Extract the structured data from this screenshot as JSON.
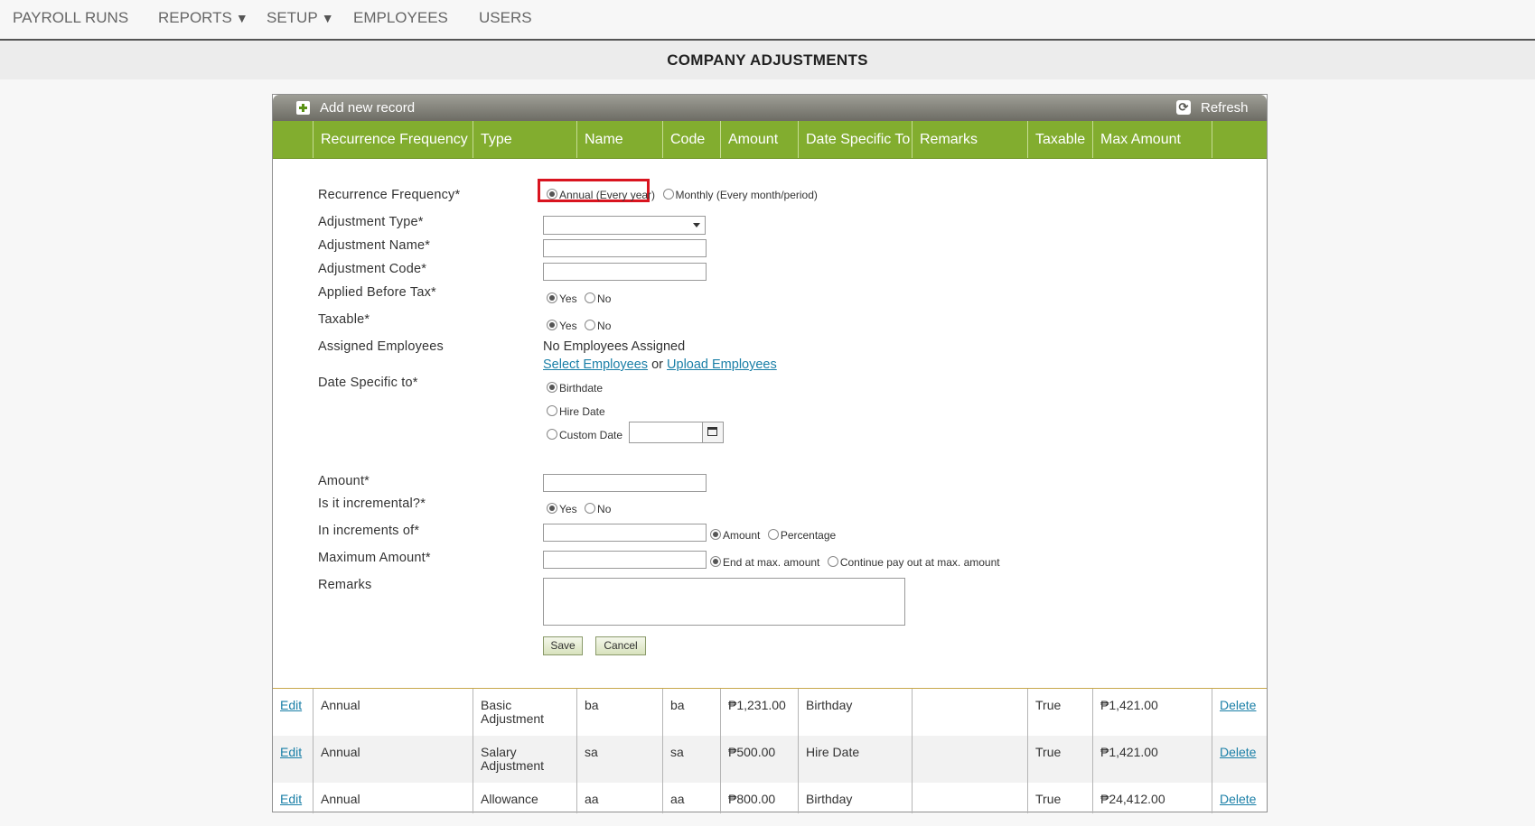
{
  "nav": {
    "items": [
      {
        "label": "PAYROLL RUNS",
        "caret": ""
      },
      {
        "label": "REPORTS",
        "caret": "▼"
      },
      {
        "label": "SETUP",
        "caret": "▼"
      },
      {
        "label": "EMPLOYEES",
        "caret": ""
      },
      {
        "label": "USERS",
        "caret": ""
      }
    ]
  },
  "page": {
    "title": "COMPANY ADJUSTMENTS"
  },
  "toolbar": {
    "add_label": "Add new record",
    "refresh_label": "Refresh",
    "add_icon": "plus-icon",
    "refresh_icon": "refresh-icon"
  },
  "columns": [
    "Recurrence Frequency",
    "Type",
    "Name",
    "Code",
    "Amount",
    "Date Specific To",
    "Remarks",
    "Taxable",
    "Max Amount"
  ],
  "form": {
    "recurrence": {
      "label": "Recurrence Frequency*",
      "options": [
        "Annual (Every year)",
        "Monthly (Every month/period)"
      ],
      "selected": "Annual (Every year)"
    },
    "adjustment_type": {
      "label": "Adjustment Type*",
      "value": ""
    },
    "adjustment_name": {
      "label": "Adjustment Name*",
      "value": ""
    },
    "adjustment_code": {
      "label": "Adjustment Code*",
      "value": ""
    },
    "applied_before_tax": {
      "label": "Applied Before Tax*",
      "options": [
        "Yes",
        "No"
      ],
      "selected": "Yes"
    },
    "taxable": {
      "label": "Taxable*",
      "options": [
        "Yes",
        "No"
      ],
      "selected": "Yes"
    },
    "assigned_employees": {
      "label": "Assigned Employees",
      "status": "No Employees Assigned",
      "select_link": "Select Employees",
      "or_text": "or",
      "upload_link": "Upload Employees"
    },
    "date_specific": {
      "label": "Date Specific to*",
      "options": [
        "Birthdate",
        "Hire Date",
        "Custom Date"
      ],
      "selected": "Birthdate",
      "custom_date_value": ""
    },
    "amount": {
      "label": "Amount*",
      "value": ""
    },
    "incremental": {
      "label": "Is it incremental?*",
      "options": [
        "Yes",
        "No"
      ],
      "selected": "Yes"
    },
    "increments": {
      "label": "In increments of*",
      "value": "",
      "options": [
        "Amount",
        "Percentage"
      ],
      "selected": "Amount"
    },
    "maximum_amount": {
      "label": "Maximum Amount*",
      "value": "",
      "options": [
        "End at max. amount",
        "Continue pay out at max. amount"
      ],
      "selected": "End at max. amount"
    },
    "remarks": {
      "label": "Remarks",
      "value": ""
    },
    "save_label": "Save",
    "cancel_label": "Cancel"
  },
  "rows": [
    {
      "edit": "Edit",
      "recurrence": "Annual",
      "type": "Basic Adjustment",
      "name": "ba",
      "code": "ba",
      "amount": "₱1,231.00",
      "date_specific": "Birthday",
      "remarks": "",
      "taxable": "True",
      "max_amount": "₱1,421.00",
      "delete": "Delete"
    },
    {
      "edit": "Edit",
      "recurrence": "Annual",
      "type": "Salary Adjustment",
      "name": "sa",
      "code": "sa",
      "amount": "₱500.00",
      "date_specific": "Hire Date",
      "remarks": "",
      "taxable": "True",
      "max_amount": "₱1,421.00",
      "delete": "Delete"
    },
    {
      "edit": "Edit",
      "recurrence": "Annual",
      "type": "Allowance",
      "name": "aa",
      "code": "aa",
      "amount": "₱800.00",
      "date_specific": "Birthday",
      "remarks": "",
      "taxable": "True",
      "max_amount": "₱24,412.00",
      "delete": "Delete"
    }
  ],
  "colors": {
    "header_green": "#82ad2f",
    "toolbar_gray": "#8a8981",
    "highlight_red": "#d9141f",
    "link_blue": "#1a7fa7"
  }
}
